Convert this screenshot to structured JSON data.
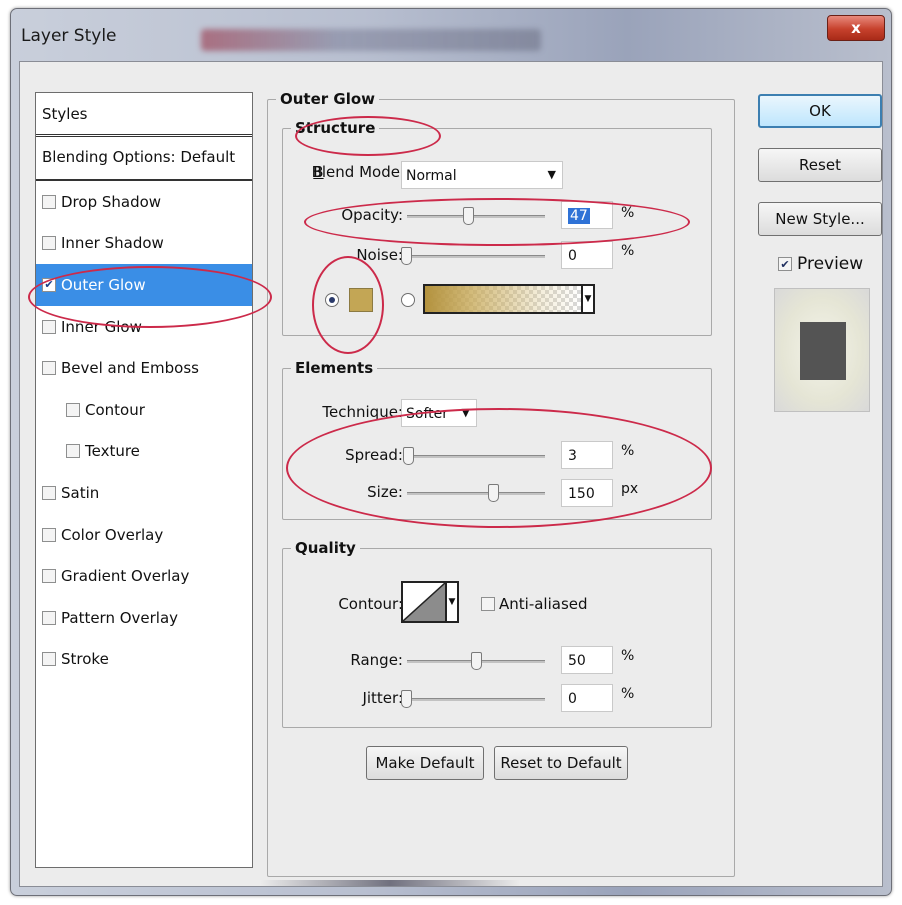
{
  "window": {
    "title": "Layer Style",
    "close_label": "x"
  },
  "styles_panel": {
    "header": "Styles",
    "blending_options": "Blending Options: Default",
    "items": [
      {
        "label": "Drop Shadow",
        "checked": false,
        "indent": false
      },
      {
        "label": "Inner Shadow",
        "checked": false,
        "indent": false
      },
      {
        "label": "Outer Glow",
        "checked": true,
        "indent": false
      },
      {
        "label": "Inner Glow",
        "checked": false,
        "indent": false
      },
      {
        "label": "Bevel and Emboss",
        "checked": false,
        "indent": false
      },
      {
        "label": "Contour",
        "checked": false,
        "indent": true
      },
      {
        "label": "Texture",
        "checked": false,
        "indent": true
      },
      {
        "label": "Satin",
        "checked": false,
        "indent": false
      },
      {
        "label": "Color Overlay",
        "checked": false,
        "indent": false
      },
      {
        "label": "Gradient Overlay",
        "checked": false,
        "indent": false
      },
      {
        "label": "Pattern Overlay",
        "checked": false,
        "indent": false
      },
      {
        "label": "Stroke",
        "checked": false,
        "indent": false
      }
    ]
  },
  "outer_glow": {
    "title": "Outer Glow",
    "structure": {
      "title": "Structure",
      "blend_mode_label": "Blend Mode:",
      "blend_mode_value": "Normal",
      "opacity_label": "Opacity:",
      "opacity_value": "47",
      "opacity_unit": "%",
      "noise_label": "Noise:",
      "noise_value": "0",
      "noise_unit": "%",
      "glow_color": "#c3a655"
    },
    "elements": {
      "title": "Elements",
      "technique_label": "Technique:",
      "technique_value": "Softer",
      "spread_label": "Spread:",
      "spread_value": "3",
      "spread_unit": "%",
      "size_label": "Size:",
      "size_value": "150",
      "size_unit": "px"
    },
    "quality": {
      "title": "Quality",
      "contour_label": "Contour:",
      "anti_aliased_label": "Anti-aliased",
      "range_label": "Range:",
      "range_value": "50",
      "range_unit": "%",
      "jitter_label": "Jitter:",
      "jitter_value": "0",
      "jitter_unit": "%"
    },
    "make_default": "Make Default",
    "reset_to_default": "Reset to Default"
  },
  "actions": {
    "ok": "OK",
    "reset": "Reset",
    "new_style": "New Style...",
    "preview_label": "Preview",
    "preview_checked": true
  },
  "colors": {
    "selection": "#3a8ee6",
    "annotation": "#cc2a4a",
    "glow": "#c3a655"
  }
}
